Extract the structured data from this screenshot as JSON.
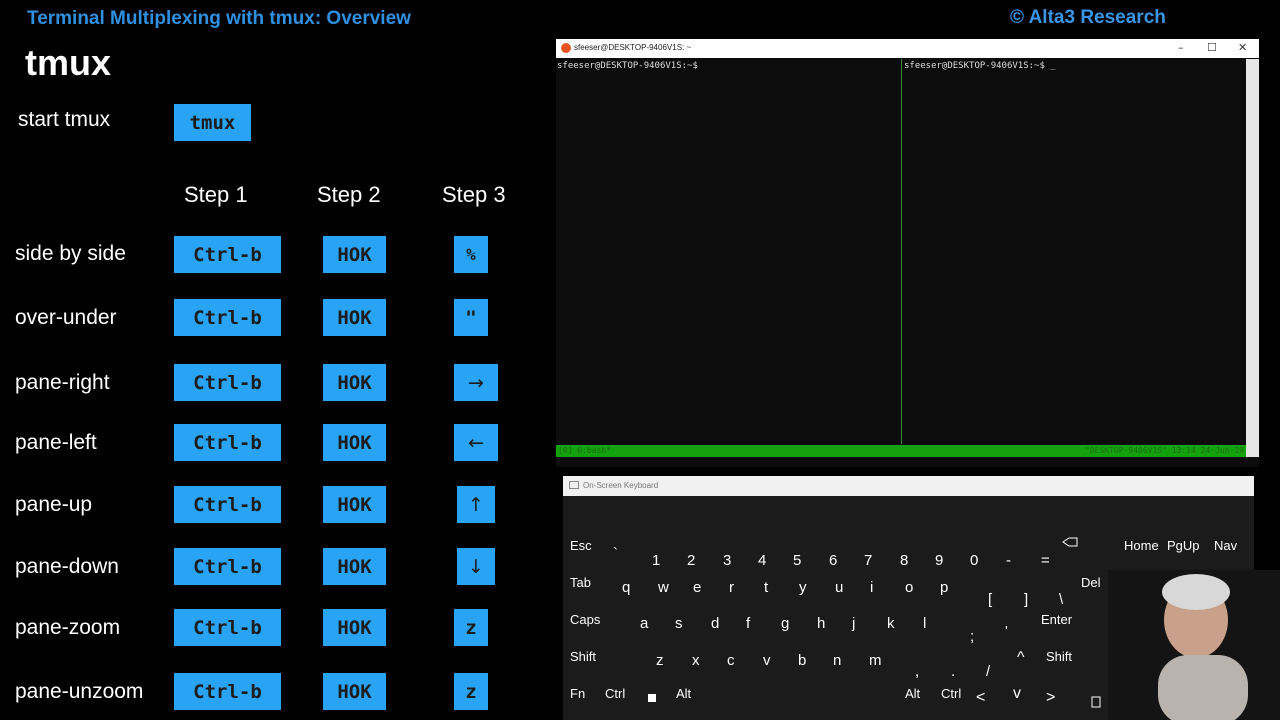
{
  "slide": {
    "title": "Terminal Multiplexing with tmux: Overview",
    "brand": "© Alta3 Research",
    "heading": "tmux",
    "start_label": "start tmux",
    "start_key": "tmux",
    "steps": [
      "Step 1",
      "Step 2",
      "Step 3"
    ],
    "rows": [
      {
        "label": "side by side",
        "k1": "Ctrl-b",
        "k2": "HOK",
        "k3": "%"
      },
      {
        "label": "over-under",
        "k1": "Ctrl-b",
        "k2": "HOK",
        "k3": "\""
      },
      {
        "label": "pane-right",
        "k1": "Ctrl-b",
        "k2": "HOK",
        "k3": "→"
      },
      {
        "label": "pane-left",
        "k1": "Ctrl-b",
        "k2": "HOK",
        "k3": "←"
      },
      {
        "label": "pane-up",
        "k1": "Ctrl-b",
        "k2": "HOK",
        "k3": "↑"
      },
      {
        "label": "pane-down",
        "k1": "Ctrl-b",
        "k2": "HOK",
        "k3": "↓"
      },
      {
        "label": "pane-zoom",
        "k1": "Ctrl-b",
        "k2": "HOK",
        "k3": "z"
      },
      {
        "label": "pane-unzoom",
        "k1": "Ctrl-b",
        "k2": "HOK",
        "k3": "z"
      }
    ]
  },
  "terminal": {
    "title": "sfeeser@DESKTOP-9406V1S: ~",
    "left_prompt": "sfeeser@DESKTOP-9406V1S:~$",
    "right_prompt": "sfeeser@DESKTOP-9406V1S:~$ _",
    "status_left": "[0] 0:bash*",
    "status_right": "\"DESKTOP-9406V1S\" 13:14 24-Jun-19",
    "controls": {
      "minimize": "–",
      "maximize": "☐",
      "close": "✕"
    }
  },
  "keyboard": {
    "title": "On-Screen Keyboard",
    "icons": [
      "keyboard-icon",
      "windows-icon",
      "backspace-icon",
      "menu-icon"
    ]
  }
}
